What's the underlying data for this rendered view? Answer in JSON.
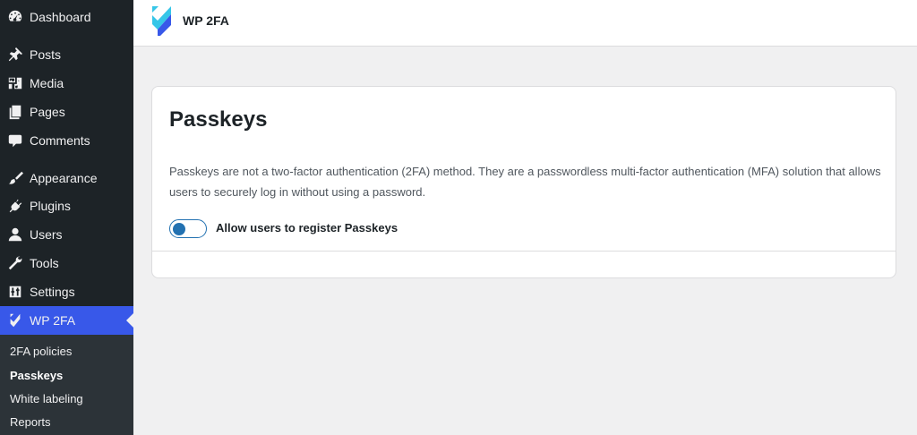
{
  "sidebar": {
    "items": [
      {
        "label": "Dashboard",
        "icon": "dashboard-icon"
      },
      {
        "label": "Posts",
        "icon": "pin-icon"
      },
      {
        "label": "Media",
        "icon": "media-icon"
      },
      {
        "label": "Pages",
        "icon": "pages-icon"
      },
      {
        "label": "Comments",
        "icon": "comment-icon"
      },
      {
        "label": "Appearance",
        "icon": "brush-icon"
      },
      {
        "label": "Plugins",
        "icon": "plugin-icon"
      },
      {
        "label": "Users",
        "icon": "user-icon"
      },
      {
        "label": "Tools",
        "icon": "wrench-icon"
      },
      {
        "label": "Settings",
        "icon": "settings-icon"
      },
      {
        "label": "WP 2FA",
        "icon": "wp2fa-logo-icon",
        "active": true
      }
    ],
    "submenu": [
      {
        "label": "2FA policies"
      },
      {
        "label": "Passkeys",
        "current": true
      },
      {
        "label": "White labeling"
      },
      {
        "label": "Reports"
      }
    ]
  },
  "header": {
    "brand": "WP 2FA",
    "logo_colors": [
      "#36c6e8",
      "#3858e9"
    ]
  },
  "card": {
    "title": "Passkeys",
    "description": "Passkeys are not a two-factor authentication (2FA) method. They are a passwordless multi-factor authentication (MFA) solution that allows users to securely log in without using a password.",
    "toggle": {
      "label": "Allow users to register Passkeys",
      "enabled": false
    }
  },
  "colors": {
    "sidebar_bg": "#1d2327",
    "active_menu": "#3858e9",
    "accent": "#2271b1"
  }
}
